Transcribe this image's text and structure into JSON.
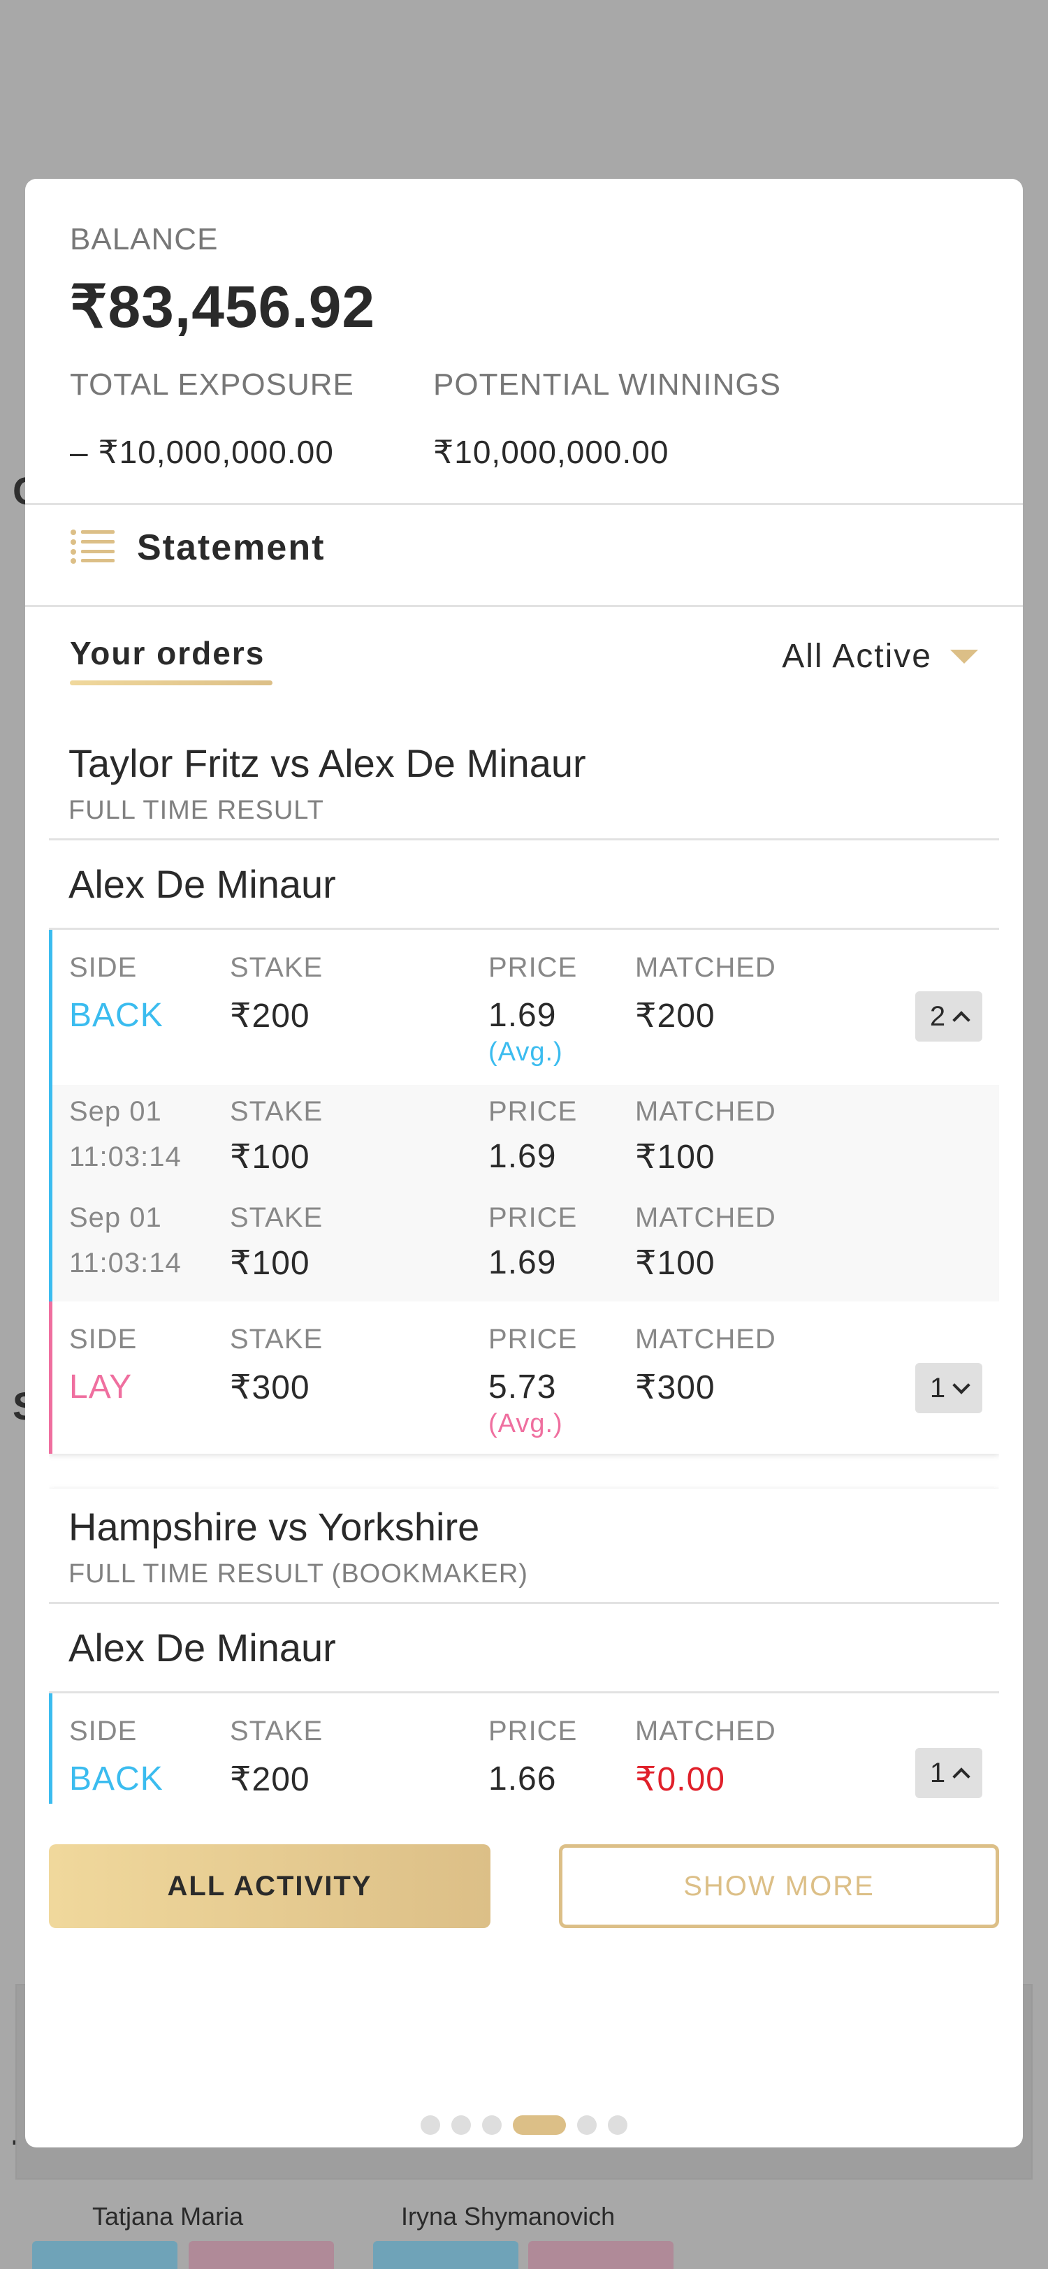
{
  "balance": {
    "label": "BALANCE",
    "amount": "₹83,456.92",
    "exposure_label": "TOTAL EXPOSURE",
    "exposure_value": "– ₹10,000,000.00",
    "winnings_label": "POTENTIAL WINNINGS",
    "winnings_value": "₹10,000,000.00"
  },
  "statement": {
    "title": "Statement",
    "icon": "list-icon"
  },
  "orders": {
    "tab_label": "Your orders",
    "filter_label": "All Active"
  },
  "cards": [
    {
      "event": "Taylor Fritz vs Alex De Minaur",
      "market": "FULL TIME RESULT",
      "selection": "Alex De Minaur",
      "back": {
        "side_label": "SIDE",
        "side": "BACK",
        "stake_label": "STAKE",
        "stake": "₹200",
        "price_label": "PRICE",
        "price": "1.69",
        "avg": "(Avg.)",
        "matched_label": "MATCHED",
        "matched": "₹200",
        "count": "2",
        "details": [
          {
            "date": "Sep 01",
            "time": "11:03:14",
            "stake_label": "STAKE",
            "stake": "₹100",
            "price_label": "PRICE",
            "price": "1.69",
            "matched_label": "MATCHED",
            "matched": "₹100"
          },
          {
            "date": "Sep 01",
            "time": "11:03:14",
            "stake_label": "STAKE",
            "stake": "₹100",
            "price_label": "PRICE",
            "price": "1.69",
            "matched_label": "MATCHED",
            "matched": "₹100"
          }
        ]
      },
      "lay": {
        "side_label": "SIDE",
        "side": "LAY",
        "stake_label": "STAKE",
        "stake": "₹300",
        "price_label": "PRICE",
        "price": "5.73",
        "avg": "(Avg.)",
        "matched_label": "MATCHED",
        "matched": "₹300",
        "count": "1"
      }
    },
    {
      "event": "Hampshire vs Yorkshire",
      "market": "FULL TIME RESULT (BOOKMAKER)",
      "selection": "Alex De Minaur",
      "back": {
        "side_label": "SIDE",
        "side": "BACK",
        "stake_label": "STAKE",
        "stake": "₹200",
        "price_label": "PRICE",
        "price": "1.66",
        "matched_label": "MATCHED",
        "matched": "₹0.00",
        "count": "1"
      }
    }
  ],
  "buttons": {
    "all_activity": "ALL ACTIVITY",
    "show_more": "SHOW MORE"
  },
  "pagination": {
    "total": 6,
    "active": 4
  },
  "background": {
    "player_1": "Tatjana Maria",
    "player_2": "Iryna Shymanovich"
  },
  "colors": {
    "gold": "#dcbf87",
    "back": "#3bbcef",
    "lay": "#ef6f9f",
    "negative": "#e0202a"
  }
}
